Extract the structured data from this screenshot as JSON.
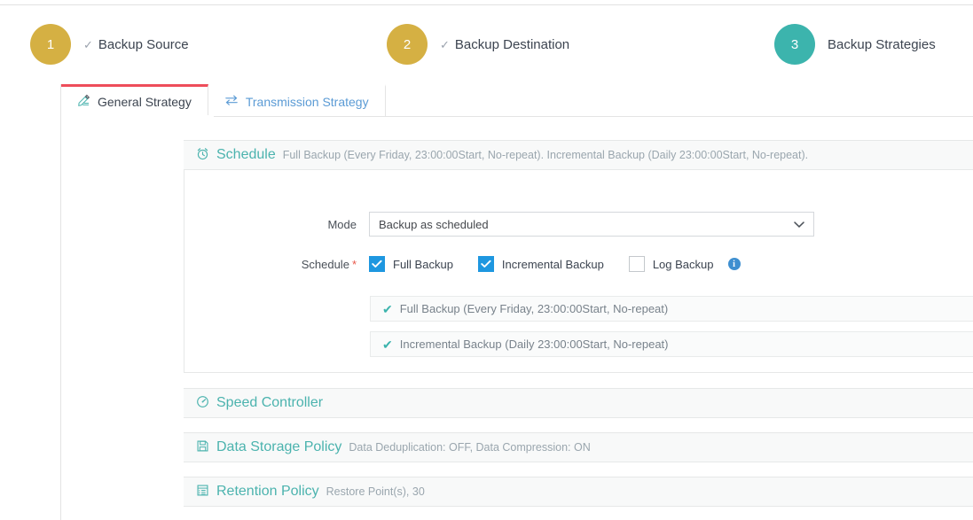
{
  "steps": [
    {
      "number": "1",
      "label": "Backup Source",
      "color": "#d5b043",
      "completed": true
    },
    {
      "number": "2",
      "label": "Backup Destination",
      "color": "#d5b043",
      "completed": true
    },
    {
      "number": "3",
      "label": "Backup Strategies",
      "color": "#3cb4ad",
      "completed": false
    }
  ],
  "tabs": [
    {
      "label": "General Strategy",
      "icon": "edit-pencil-icon",
      "active": true
    },
    {
      "label": "Transmission Strategy",
      "icon": "transfer-arrows-icon",
      "active": false
    }
  ],
  "panels": {
    "schedule": {
      "title": "Schedule",
      "icon": "alarm-clock-icon",
      "summary": "Full Backup (Every Friday, 23:00:00Start, No-repeat). Incremental Backup (Daily 23:00:00Start, No-repeat).",
      "mode": {
        "label": "Mode",
        "value": "Backup as scheduled",
        "options": [
          "Backup as scheduled"
        ]
      },
      "schedule_field": {
        "label": "Schedule",
        "required_marker": "*",
        "checkboxes": [
          {
            "label": "Full Backup",
            "checked": true
          },
          {
            "label": "Incremental Backup",
            "checked": true
          },
          {
            "label": "Log Backup",
            "checked": false
          }
        ],
        "info_glyph": "i"
      },
      "detail_rows": [
        "Full Backup (Every Friday, 23:00:00Start, No-repeat)",
        "Incremental Backup (Daily 23:00:00Start, No-repeat)"
      ]
    },
    "speed_controller": {
      "title": "Speed Controller",
      "icon": "gauge-icon",
      "summary": ""
    },
    "data_storage_policy": {
      "title": "Data Storage Policy",
      "icon": "floppy-disk-icon",
      "summary": "Data Deduplication: OFF, Data Compression: ON"
    },
    "retention_policy": {
      "title": "Retention Policy",
      "icon": "archive-box-icon",
      "summary": "Restore Point(s), 30"
    }
  },
  "colors": {
    "accent_teal": "#4bb3ae",
    "step_gold": "#d5b043",
    "active_tab_bar": "#ee4d5a",
    "checkbox_blue": "#1e97e0",
    "required_red": "#e8574a"
  }
}
